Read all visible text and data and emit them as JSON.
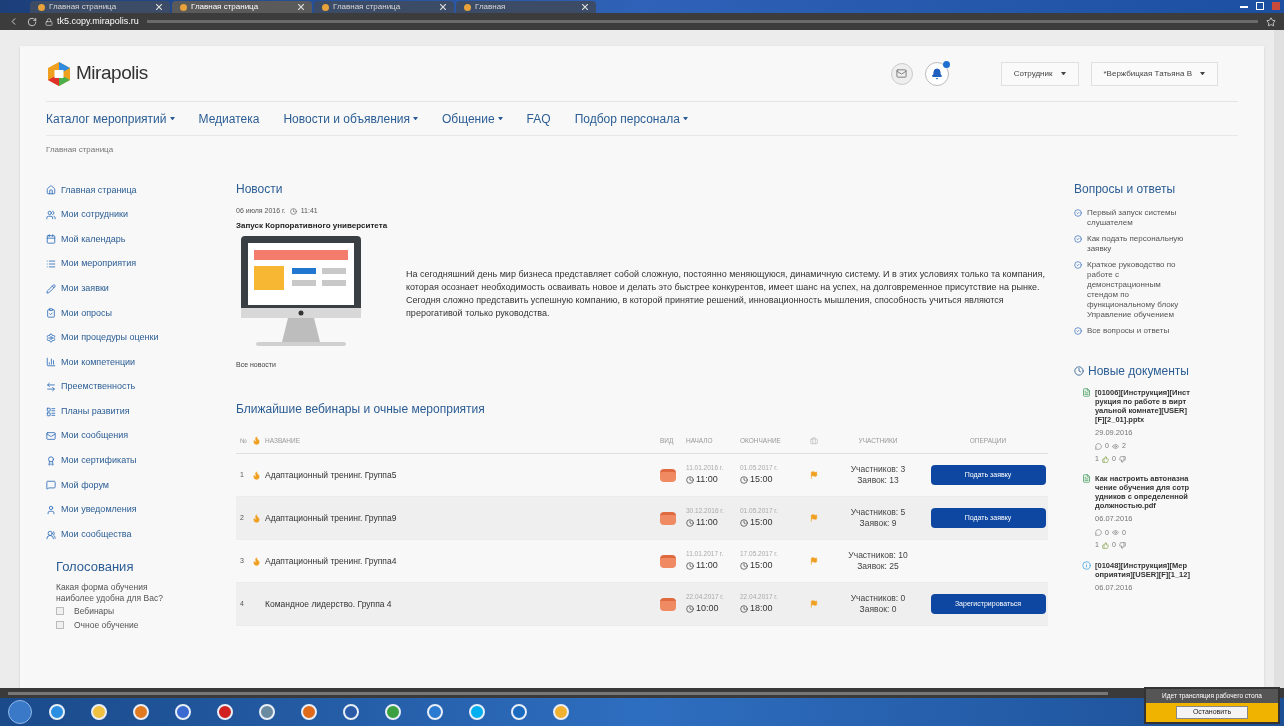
{
  "browser": {
    "tabs": [
      {
        "title": "Главная страница",
        "selected": false
      },
      {
        "title": "Главная страница",
        "selected": true
      },
      {
        "title": "Главная страница",
        "selected": false
      },
      {
        "title": "Главная",
        "selected": false
      }
    ],
    "address": "tk5.copy.mirapolis.ru"
  },
  "header": {
    "logo": "Mirapolis",
    "notifications": true,
    "role": "Сотрудник",
    "user": "*Вержбицкая Татьяна В"
  },
  "nav": [
    {
      "label": "Каталог мероприятий",
      "dropdown": true
    },
    {
      "label": "Медиатека",
      "dropdown": false
    },
    {
      "label": "Новости и объявления",
      "dropdown": true
    },
    {
      "label": "Общение",
      "dropdown": true
    },
    {
      "label": "FAQ",
      "dropdown": false
    },
    {
      "label": "Подбор персонала",
      "dropdown": true
    }
  ],
  "breadcrumb": "Главная страница",
  "sidebar": {
    "items": [
      {
        "kind": "home",
        "label": "Главная страница"
      },
      {
        "kind": "users",
        "label": "Мои сотрудники"
      },
      {
        "kind": "calendar",
        "label": "Мой календарь"
      },
      {
        "kind": "list",
        "label": "Мои мероприятия"
      },
      {
        "kind": "pencil",
        "label": "Мои заявки"
      },
      {
        "kind": "survey",
        "label": "Мои опросы"
      },
      {
        "kind": "gear",
        "label": "Мои процедуры оценки"
      },
      {
        "kind": "chart",
        "label": "Мои компетенции"
      },
      {
        "kind": "arrows",
        "label": "Преемственность"
      },
      {
        "kind": "plan",
        "label": "Планы развития"
      },
      {
        "kind": "mail",
        "label": "Мои сообщения"
      },
      {
        "kind": "award",
        "label": "Мои сертификаты"
      },
      {
        "kind": "chat",
        "label": "Мой форум"
      },
      {
        "kind": "person",
        "label": "Мои уведомления"
      },
      {
        "kind": "group",
        "label": "Мои сообщества"
      }
    ]
  },
  "poll": {
    "title": "Голосования",
    "question": "Какая форма обучения наиболее удобна для Вас?",
    "options": [
      {
        "label": "Вебинары",
        "checked": false
      },
      {
        "label": "Очное обучение",
        "checked": false
      }
    ]
  },
  "news": {
    "title": "Новости",
    "date": "06 июля 2016 г.",
    "time": "11:41",
    "headline": "Запуск Корпоративного университета",
    "body": "На сегодняшний день мир бизнеса представляет собой сложную, постоянно меняющуюся, динамичную систему. И в этих условиях только та компания, которая осознает необходимость осваивать новое и делать это быстрее конкурентов, имеет шанс на успех, на долговременное присутствие на рынке. Сегодня сложно представить успешную компанию, в которой принятие решений, инновационность мышления, способность учиться являются прерогативой только руководства.",
    "all_link": "Все новости"
  },
  "events": {
    "title": "Ближайшие вебинары и очные мероприятия",
    "columns": {
      "number": "№",
      "name": "НАЗВАНИЕ",
      "type": "ВИД",
      "start": "НАЧАЛО",
      "end": "ОКОНЧАНИЕ",
      "participants": "УЧАСТНИКИ",
      "operations": "ОПЕРАЦИИ"
    },
    "rows": [
      {
        "number": "1",
        "hot": true,
        "name": "Адаптационный тренинг. Группа5",
        "start_date": "11.01.2016 г.",
        "start_time": "11:00",
        "end_date": "01.05.2017 г.",
        "end_time": "15:00",
        "participants": "Участников: 3",
        "requests": "Заявок: 13",
        "action": "Подать заявку"
      },
      {
        "number": "2",
        "hot": true,
        "name": "Адаптационный тренинг. Группа9",
        "start_date": "30.12.2016 г.",
        "start_time": "11:00",
        "end_date": "01.05.2017 г.",
        "end_time": "15:00",
        "participants": "Участников: 5",
        "requests": "Заявок: 9",
        "action": "Подать заявку"
      },
      {
        "number": "3",
        "hot": true,
        "name": "Адаптационный тренинг. Группа4",
        "start_date": "11.01.2017 г.",
        "start_time": "11:00",
        "end_date": "17.05.2017 г.",
        "end_time": "15:00",
        "participants": "Участников: 10",
        "requests": "Заявок: 25"
      },
      {
        "number": "4",
        "hot": false,
        "name": "Командное лидерство. Группа 4",
        "start_date": "22.04.2017 г.",
        "start_time": "10:00",
        "end_date": "22.04.2017 г.",
        "end_time": "18:00",
        "participants": "Участников: 0",
        "requests": "Заявок: 0",
        "action": "Зарегистрироваться"
      }
    ]
  },
  "faq": {
    "title": "Вопросы и ответы",
    "items": [
      "Первый запуск системы слушателем",
      "Как подать персональную заявку",
      "Краткое руководство по работе с демонстрационным стендом по функциональному блоку Управление обучением",
      "Все вопросы и ответы"
    ]
  },
  "documents": {
    "title": "Новые документы",
    "items": [
      {
        "kind": "file",
        "title": "[01006][Инструкция][Инструкция по работе в виртуальной комнате][USER][F][2_01].pptx",
        "date": "29.09.2016",
        "comments": "0",
        "views": "2",
        "likes": "1",
        "dislikes": "0"
      },
      {
        "kind": "file",
        "title": "Как настроить автоназначение обучения для сотрудников с определенной должностью.pdf",
        "date": "06.07.2016",
        "comments": "0",
        "views": "0",
        "likes": "1",
        "dislikes": "0"
      },
      {
        "kind": "info",
        "title": "[01048][Инструкция][Мероприятия][USER][F][1_12]",
        "date": "06.07.2016"
      }
    ]
  },
  "sharing_popup": {
    "message": "Идет трансляция рабочего стола",
    "button": "Остановить"
  }
}
